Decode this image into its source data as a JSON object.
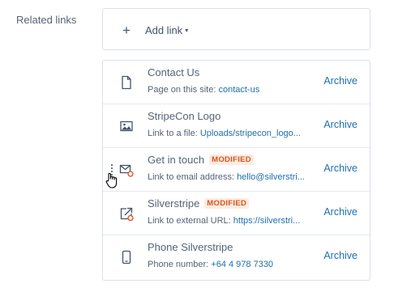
{
  "field": {
    "label": "Related links"
  },
  "add": {
    "plus": "+",
    "label": "Add link",
    "caret": "▾"
  },
  "links": [
    {
      "title": "Contact Us",
      "badge": "",
      "desc": "Page on this site:",
      "value": "contact-us",
      "action": "Archive",
      "icon": "page-icon"
    },
    {
      "title": "StripeCon Logo",
      "badge": "",
      "desc": "Link to a file:",
      "value": "Uploads/stripecon_logo...",
      "action": "Archive",
      "icon": "image-icon"
    },
    {
      "title": "Get in touch",
      "badge": "MODIFIED",
      "desc": "Link to email address:",
      "value": "hello@silverstri...",
      "action": "Archive",
      "icon": "email-icon"
    },
    {
      "title": "Silverstripe",
      "badge": "MODIFIED",
      "desc": "Link to external URL:",
      "value": "https://silverstri...",
      "action": "Archive",
      "icon": "external-link-icon"
    },
    {
      "title": "Phone Silverstripe",
      "badge": "",
      "desc": "Phone number:",
      "value": "+64 4 978 7330",
      "action": "Archive",
      "icon": "phone-icon"
    }
  ],
  "colors": {
    "accent": "#1f6faa",
    "modified": "#d9531e",
    "modified_bg": "#fdecdf",
    "border": "#dbe1e8"
  }
}
